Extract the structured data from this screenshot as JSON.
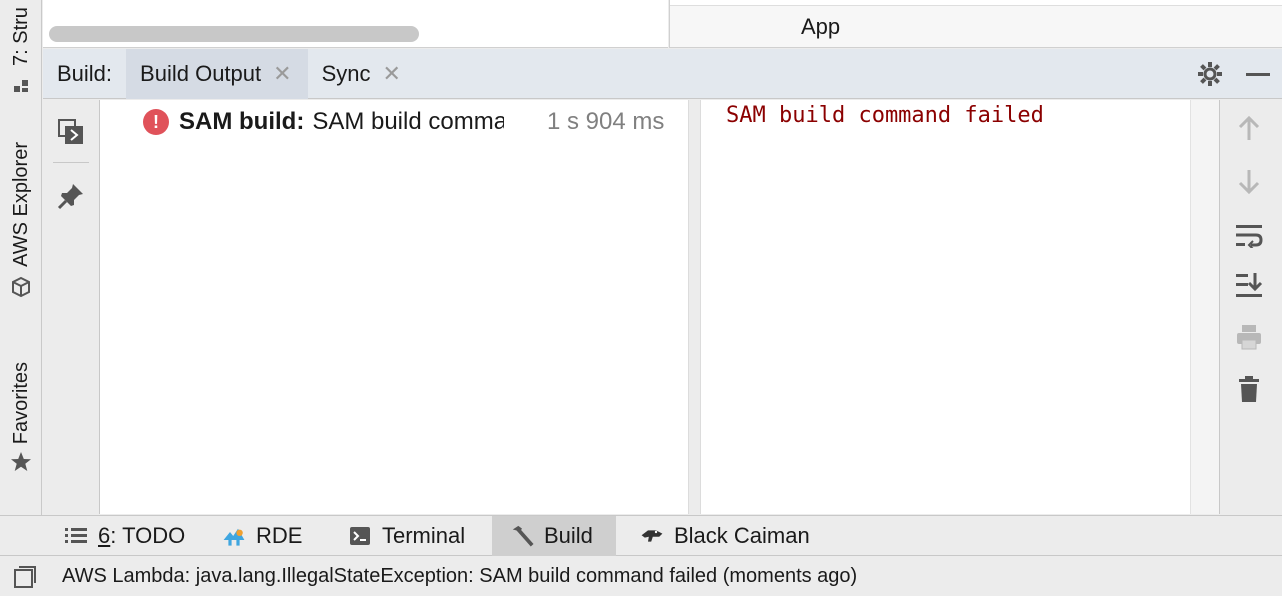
{
  "left_strip": {
    "structure_tab": "7: Stru",
    "aws_explorer_tab": "AWS Explorer",
    "favorites_tab": "Favorites"
  },
  "editor": {
    "right_pane_title": "App"
  },
  "build_window": {
    "title": "Build:",
    "tabs": [
      {
        "label": "Build Output",
        "active": true
      },
      {
        "label": "Sync",
        "active": false
      }
    ],
    "tree": {
      "status": "error",
      "bold_label": "SAM build:",
      "message": "SAM build command failed",
      "duration": "1 s 904 ms"
    },
    "console_output": "SAM build command failed",
    "console_color": "#8b0000"
  },
  "bottom_tabs": [
    {
      "prefix": "6",
      "label": ": TODO",
      "icon": "list-icon"
    },
    {
      "label": "RDE",
      "icon": "rde-icon"
    },
    {
      "label": "Terminal",
      "icon": "terminal-icon"
    },
    {
      "label": "Build",
      "icon": "hammer-icon",
      "active": true
    },
    {
      "label": "Black Caiman",
      "icon": "caiman-icon"
    }
  ],
  "status_bar": {
    "message": "AWS Lambda: java.lang.IllegalStateException: SAM build command failed (moments ago)"
  },
  "colors": {
    "error_red": "#e0525a",
    "header_bg": "#e3e8ee",
    "active_tab_bg": "#d5dbe4"
  }
}
